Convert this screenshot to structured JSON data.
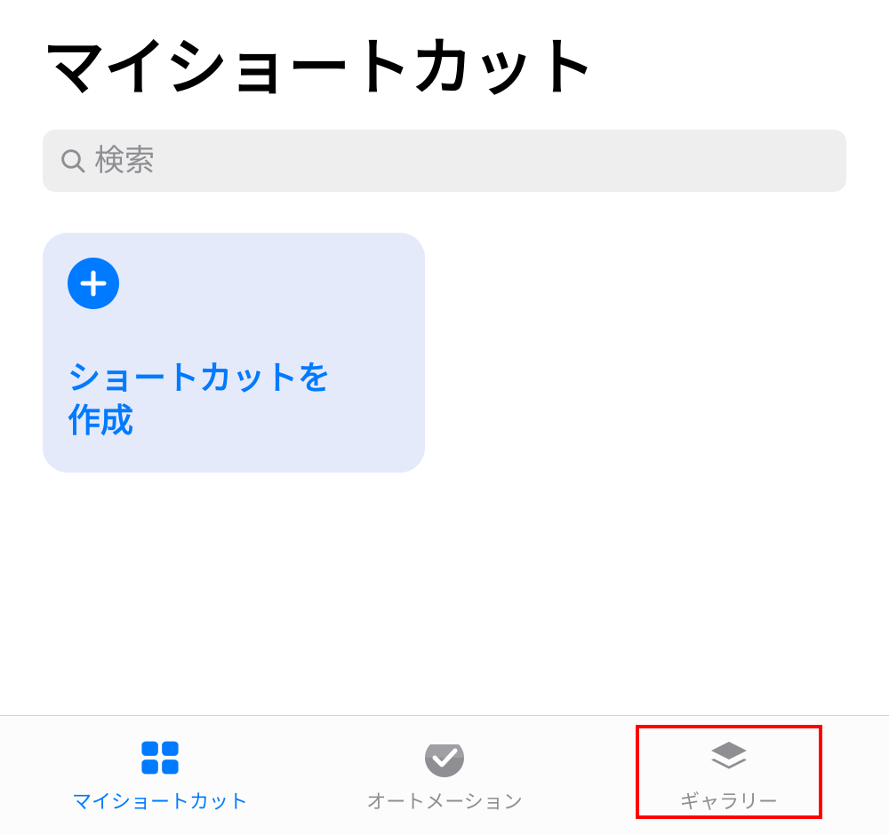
{
  "header": {
    "title": "マイショートカット"
  },
  "search": {
    "placeholder": "検索"
  },
  "card": {
    "create_label": "ショートカットを\n作成"
  },
  "tabs": {
    "my_shortcuts": "マイショートカット",
    "automation": "オートメーション",
    "gallery": "ギャラリー"
  },
  "colors": {
    "accent": "#007aff",
    "inactive": "#8e8e93",
    "card_bg": "#e5eafa",
    "highlight": "#ff0000"
  }
}
